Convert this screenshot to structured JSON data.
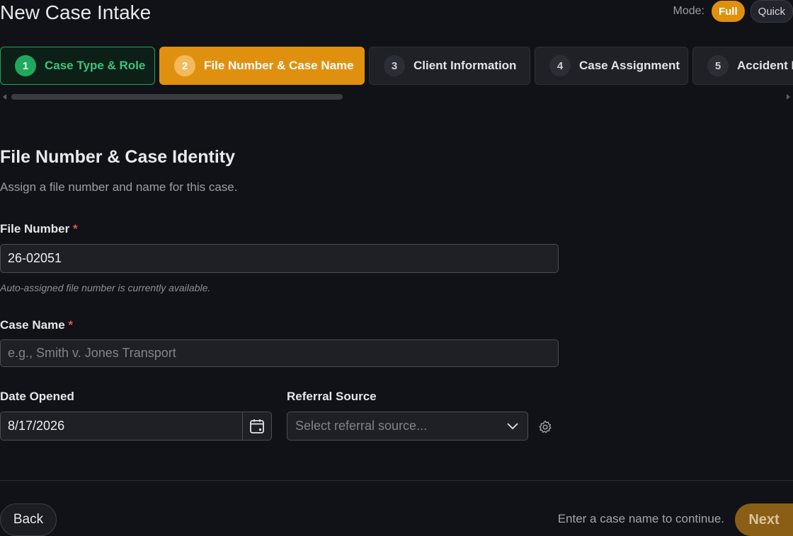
{
  "header": {
    "title": "New Case Intake",
    "mode_label": "Mode:",
    "mode_options": [
      "Full",
      "Quick"
    ],
    "mode_selected": "Full"
  },
  "steps": [
    {
      "number": "1",
      "label": "Case Type & Role",
      "state": "done"
    },
    {
      "number": "2",
      "label": "File Number & Case Name",
      "state": "current"
    },
    {
      "number": "3",
      "label": "Client Information",
      "state": "todo"
    },
    {
      "number": "4",
      "label": "Case Assignment",
      "state": "todo"
    },
    {
      "number": "5",
      "label": "Accident D",
      "state": "todo"
    }
  ],
  "section": {
    "title": "File Number & Case Identity",
    "subtitle": "Assign a file number and name for this case."
  },
  "fields": {
    "file_number": {
      "label": "File Number",
      "required_mark": "*",
      "value": "26-02051",
      "hint": "Auto-assigned file number is currently available."
    },
    "case_name": {
      "label": "Case Name",
      "required_mark": "*",
      "value": "",
      "placeholder": "e.g., Smith v. Jones Transport"
    },
    "date_opened": {
      "label": "Date Opened",
      "value": "8/17/2026",
      "icon": "calendar-icon"
    },
    "referral_source": {
      "label": "Referral Source",
      "placeholder": "Select referral source...",
      "icon": "chevron-down-icon",
      "settings_icon": "gear-icon"
    }
  },
  "footer": {
    "back_label": "Back",
    "message": "Enter a case name to continue.",
    "next_label": "Next"
  },
  "colors": {
    "accent": "#e0900f",
    "done": "#20a85e",
    "background": "#111217",
    "required": "#e25555"
  }
}
